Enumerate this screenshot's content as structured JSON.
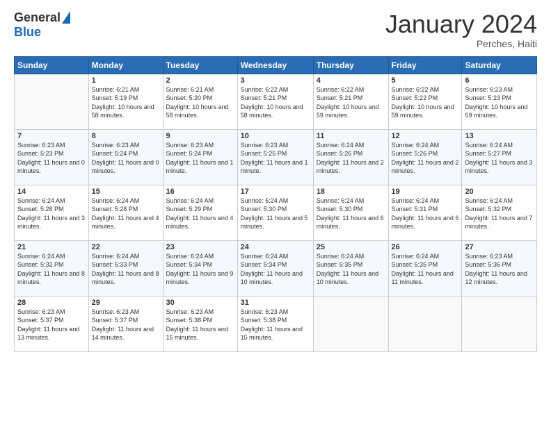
{
  "header": {
    "logo_general": "General",
    "logo_blue": "Blue",
    "month_year": "January 2024",
    "location": "Perches, Haiti"
  },
  "days_of_week": [
    "Sunday",
    "Monday",
    "Tuesday",
    "Wednesday",
    "Thursday",
    "Friday",
    "Saturday"
  ],
  "weeks": [
    [
      {
        "day": "",
        "sunrise": "",
        "sunset": "",
        "daylight": ""
      },
      {
        "day": "1",
        "sunrise": "Sunrise: 6:21 AM",
        "sunset": "Sunset: 5:19 PM",
        "daylight": "Daylight: 10 hours and 58 minutes."
      },
      {
        "day": "2",
        "sunrise": "Sunrise: 6:21 AM",
        "sunset": "Sunset: 5:20 PM",
        "daylight": "Daylight: 10 hours and 58 minutes."
      },
      {
        "day": "3",
        "sunrise": "Sunrise: 6:22 AM",
        "sunset": "Sunset: 5:21 PM",
        "daylight": "Daylight: 10 hours and 58 minutes."
      },
      {
        "day": "4",
        "sunrise": "Sunrise: 6:22 AM",
        "sunset": "Sunset: 5:21 PM",
        "daylight": "Daylight: 10 hours and 59 minutes."
      },
      {
        "day": "5",
        "sunrise": "Sunrise: 6:22 AM",
        "sunset": "Sunset: 5:22 PM",
        "daylight": "Daylight: 10 hours and 59 minutes."
      },
      {
        "day": "6",
        "sunrise": "Sunrise: 6:23 AM",
        "sunset": "Sunset: 5:23 PM",
        "daylight": "Daylight: 10 hours and 59 minutes."
      }
    ],
    [
      {
        "day": "7",
        "sunrise": "Sunrise: 6:23 AM",
        "sunset": "Sunset: 5:23 PM",
        "daylight": "Daylight: 11 hours and 0 minutes."
      },
      {
        "day": "8",
        "sunrise": "Sunrise: 6:23 AM",
        "sunset": "Sunset: 5:24 PM",
        "daylight": "Daylight: 11 hours and 0 minutes."
      },
      {
        "day": "9",
        "sunrise": "Sunrise: 6:23 AM",
        "sunset": "Sunset: 5:24 PM",
        "daylight": "Daylight: 11 hours and 1 minute."
      },
      {
        "day": "10",
        "sunrise": "Sunrise: 6:23 AM",
        "sunset": "Sunset: 5:25 PM",
        "daylight": "Daylight: 11 hours and 1 minute."
      },
      {
        "day": "11",
        "sunrise": "Sunrise: 6:24 AM",
        "sunset": "Sunset: 5:26 PM",
        "daylight": "Daylight: 11 hours and 2 minutes."
      },
      {
        "day": "12",
        "sunrise": "Sunrise: 6:24 AM",
        "sunset": "Sunset: 5:26 PM",
        "daylight": "Daylight: 11 hours and 2 minutes."
      },
      {
        "day": "13",
        "sunrise": "Sunrise: 6:24 AM",
        "sunset": "Sunset: 5:27 PM",
        "daylight": "Daylight: 11 hours and 3 minutes."
      }
    ],
    [
      {
        "day": "14",
        "sunrise": "Sunrise: 6:24 AM",
        "sunset": "Sunset: 5:28 PM",
        "daylight": "Daylight: 11 hours and 3 minutes."
      },
      {
        "day": "15",
        "sunrise": "Sunrise: 6:24 AM",
        "sunset": "Sunset: 5:28 PM",
        "daylight": "Daylight: 11 hours and 4 minutes."
      },
      {
        "day": "16",
        "sunrise": "Sunrise: 6:24 AM",
        "sunset": "Sunset: 5:29 PM",
        "daylight": "Daylight: 11 hours and 4 minutes."
      },
      {
        "day": "17",
        "sunrise": "Sunrise: 6:24 AM",
        "sunset": "Sunset: 5:30 PM",
        "daylight": "Daylight: 11 hours and 5 minutes."
      },
      {
        "day": "18",
        "sunrise": "Sunrise: 6:24 AM",
        "sunset": "Sunset: 5:30 PM",
        "daylight": "Daylight: 11 hours and 6 minutes."
      },
      {
        "day": "19",
        "sunrise": "Sunrise: 6:24 AM",
        "sunset": "Sunset: 5:31 PM",
        "daylight": "Daylight: 11 hours and 6 minutes."
      },
      {
        "day": "20",
        "sunrise": "Sunrise: 6:24 AM",
        "sunset": "Sunset: 5:32 PM",
        "daylight": "Daylight: 11 hours and 7 minutes."
      }
    ],
    [
      {
        "day": "21",
        "sunrise": "Sunrise: 6:24 AM",
        "sunset": "Sunset: 5:32 PM",
        "daylight": "Daylight: 11 hours and 8 minutes."
      },
      {
        "day": "22",
        "sunrise": "Sunrise: 6:24 AM",
        "sunset": "Sunset: 5:33 PM",
        "daylight": "Daylight: 11 hours and 8 minutes."
      },
      {
        "day": "23",
        "sunrise": "Sunrise: 6:24 AM",
        "sunset": "Sunset: 5:34 PM",
        "daylight": "Daylight: 11 hours and 9 minutes."
      },
      {
        "day": "24",
        "sunrise": "Sunrise: 6:24 AM",
        "sunset": "Sunset: 5:34 PM",
        "daylight": "Daylight: 11 hours and 10 minutes."
      },
      {
        "day": "25",
        "sunrise": "Sunrise: 6:24 AM",
        "sunset": "Sunset: 5:35 PM",
        "daylight": "Daylight: 11 hours and 10 minutes."
      },
      {
        "day": "26",
        "sunrise": "Sunrise: 6:24 AM",
        "sunset": "Sunset: 5:35 PM",
        "daylight": "Daylight: 11 hours and 11 minutes."
      },
      {
        "day": "27",
        "sunrise": "Sunrise: 6:23 AM",
        "sunset": "Sunset: 5:36 PM",
        "daylight": "Daylight: 11 hours and 12 minutes."
      }
    ],
    [
      {
        "day": "28",
        "sunrise": "Sunrise: 6:23 AM",
        "sunset": "Sunset: 5:37 PM",
        "daylight": "Daylight: 11 hours and 13 minutes."
      },
      {
        "day": "29",
        "sunrise": "Sunrise: 6:23 AM",
        "sunset": "Sunset: 5:37 PM",
        "daylight": "Daylight: 11 hours and 14 minutes."
      },
      {
        "day": "30",
        "sunrise": "Sunrise: 6:23 AM",
        "sunset": "Sunset: 5:38 PM",
        "daylight": "Daylight: 11 hours and 15 minutes."
      },
      {
        "day": "31",
        "sunrise": "Sunrise: 6:23 AM",
        "sunset": "Sunset: 5:38 PM",
        "daylight": "Daylight: 11 hours and 15 minutes."
      },
      {
        "day": "",
        "sunrise": "",
        "sunset": "",
        "daylight": ""
      },
      {
        "day": "",
        "sunrise": "",
        "sunset": "",
        "daylight": ""
      },
      {
        "day": "",
        "sunrise": "",
        "sunset": "",
        "daylight": ""
      }
    ]
  ]
}
